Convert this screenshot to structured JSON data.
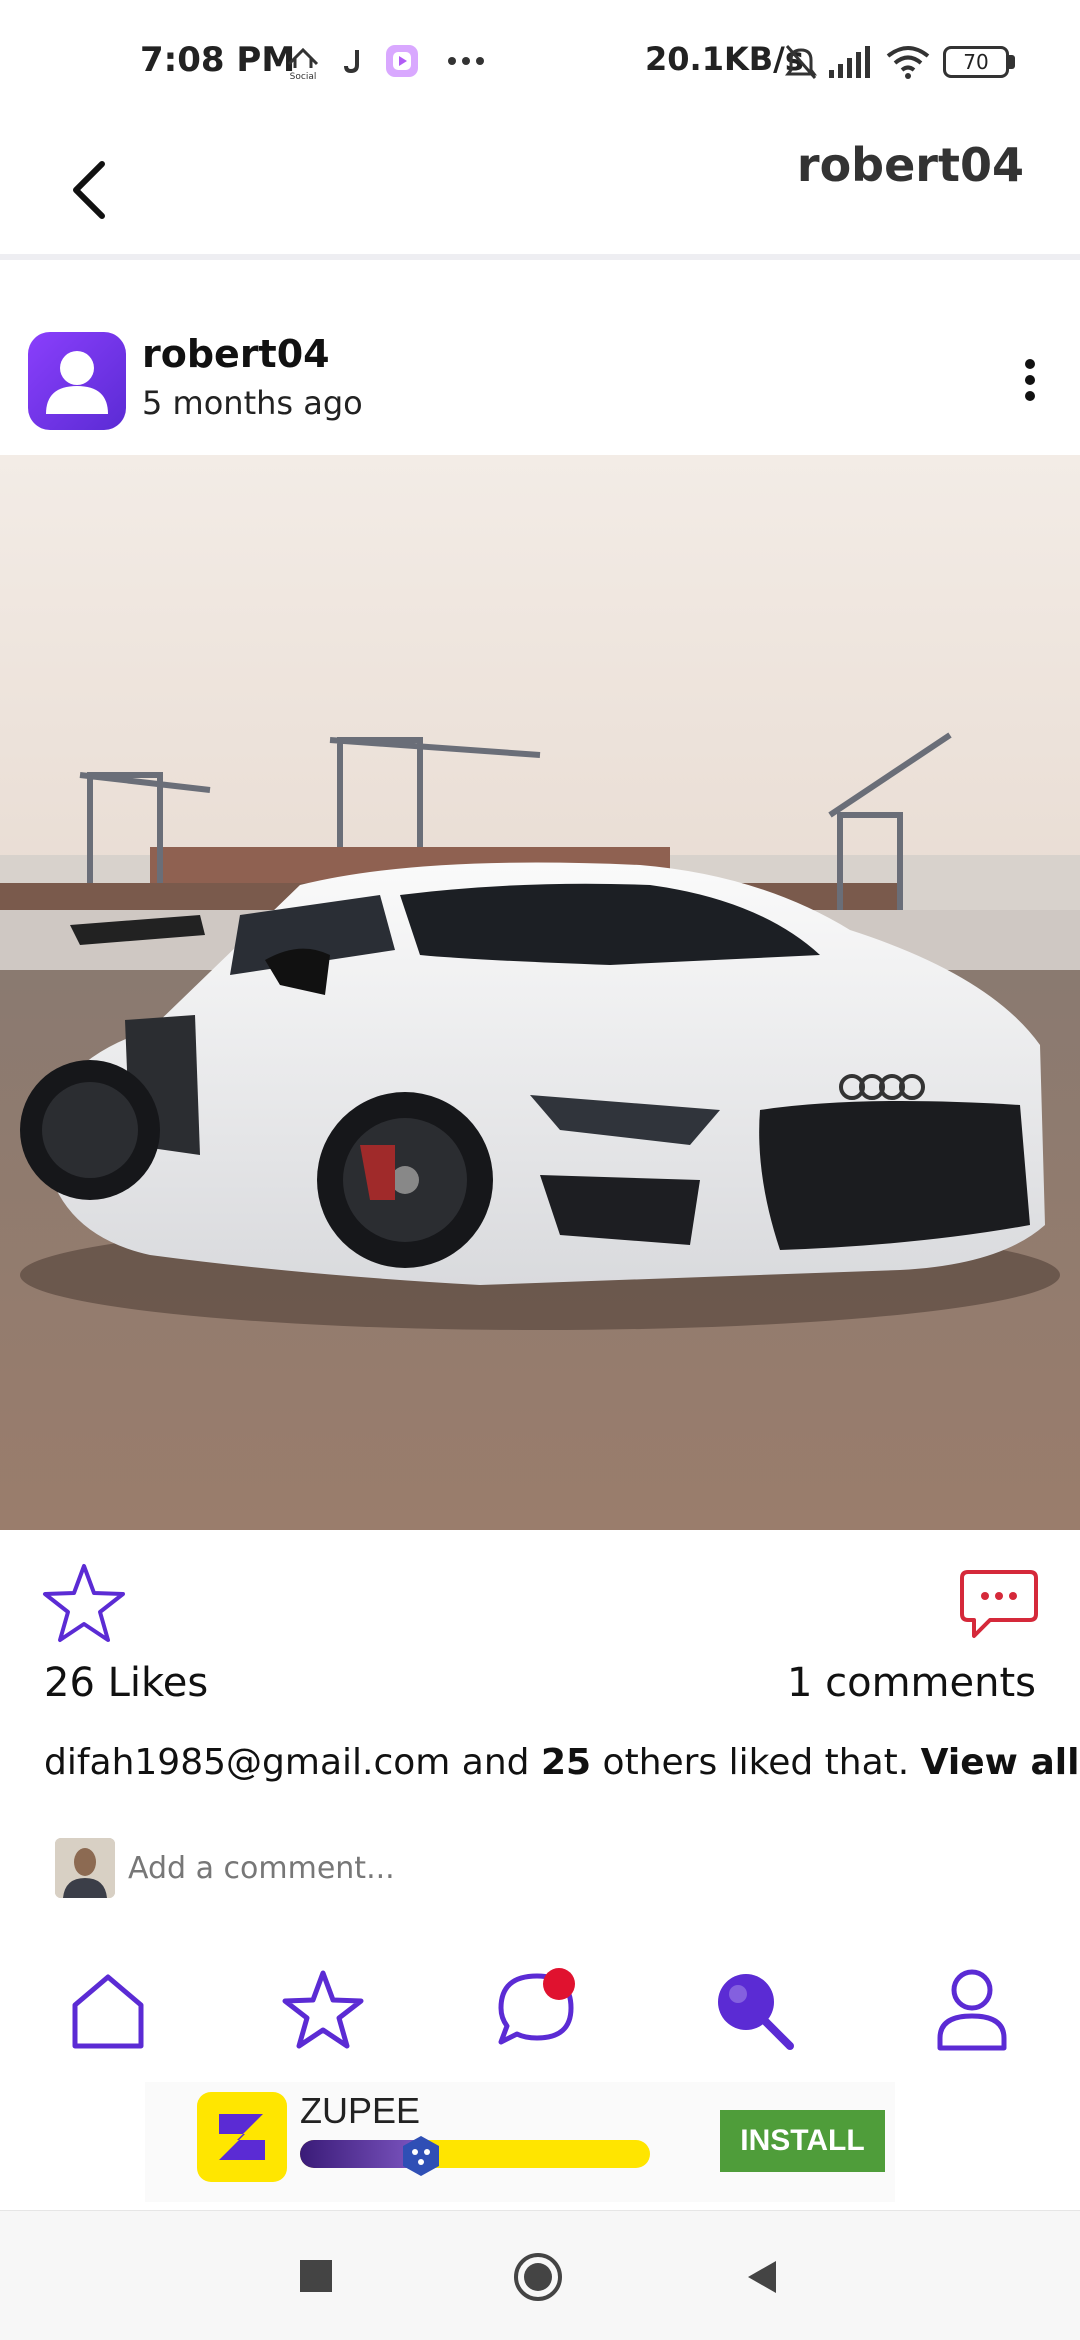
{
  "status_bar": {
    "time": "7:08 PM",
    "social_label": "Social",
    "network_speed": "20.1KB/s",
    "battery": "70",
    "icons": [
      "social-app-icon",
      "j-app-icon",
      "media-app-icon",
      "more-dots-icon",
      "mute-bell-icon",
      "signal-icon",
      "wifi-icon",
      "battery-icon"
    ]
  },
  "header": {
    "title": "robert04",
    "back_icon": "chevron-left-icon"
  },
  "post": {
    "author": "robert04",
    "time_ago": "5 months ago",
    "avatar_icon": "user-avatar-icon",
    "more_icon": "more-vertical-icon",
    "likes": "26 Likes",
    "comments": "1 comments",
    "liked_by": {
      "user": "difah1985@gmail.com",
      "and": "and",
      "others_count": "25",
      "others_text": "others liked that.",
      "view_all": "View all"
    },
    "comment_placeholder": "Add a comment..."
  },
  "nav": {
    "items": [
      {
        "icon": "home-icon"
      },
      {
        "icon": "star-icon"
      },
      {
        "icon": "chat-icon",
        "badge": true
      },
      {
        "icon": "search-icon"
      },
      {
        "icon": "profile-icon"
      }
    ]
  },
  "ad": {
    "brand": "ZUPEE",
    "cta": "INSTALL",
    "progress": 0.35
  },
  "colors": {
    "accent": "#5b2bd4",
    "comment_icon": "#d5293a",
    "badge": "#e0122f",
    "install": "#4f9d3a"
  }
}
